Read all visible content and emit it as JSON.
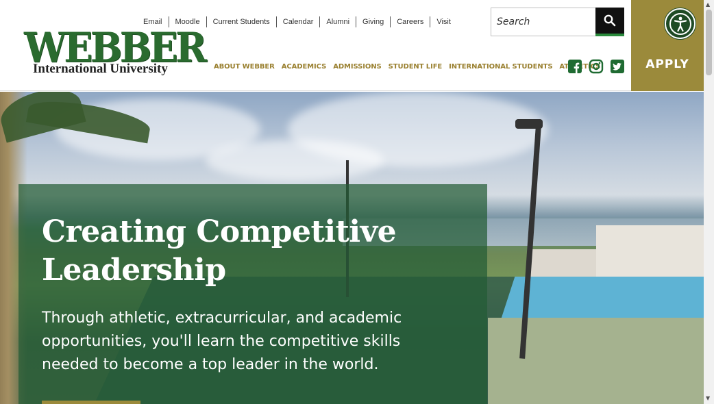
{
  "logo": {
    "word": "WEBBER",
    "sub": "International University"
  },
  "utility_nav": [
    "Email",
    "Moodle",
    "Current Students",
    "Calendar",
    "Alumni",
    "Giving",
    "Careers",
    "Visit"
  ],
  "search": {
    "placeholder": "Search"
  },
  "main_nav": [
    "ABOUT WEBBER",
    "ACADEMICS",
    "ADMISSIONS",
    "STUDENT LIFE",
    "INTERNATIONAL STUDENTS",
    "ATHLETICS"
  ],
  "social_icons": [
    "facebook-icon",
    "instagram-icon",
    "twitter-icon"
  ],
  "apply": {
    "label": "APPLY"
  },
  "hero": {
    "headline_line1": "Creating Competitive",
    "headline_line2": "Leadership",
    "subtext": "Through athletic, extracurricular, and academic opportunities, you'll learn the competitive skills needed to become a top leader in the world."
  },
  "colors": {
    "brand_green": "#2a6b2f",
    "gold": "#9b8a3b",
    "nav_gold": "#9a8030"
  }
}
